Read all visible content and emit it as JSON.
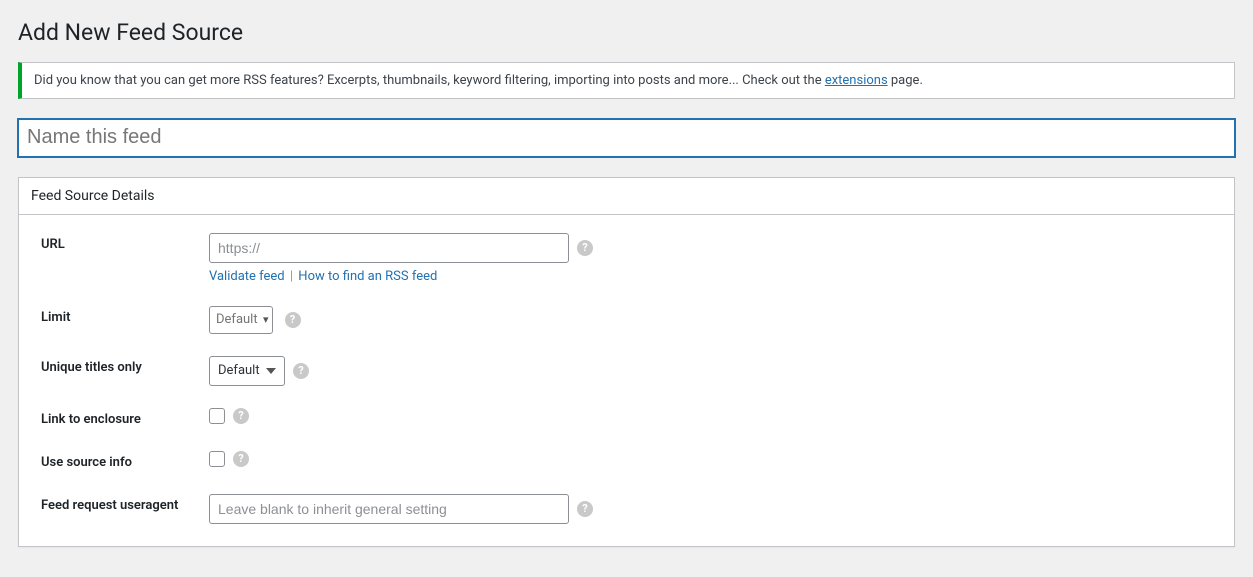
{
  "page_title": "Add New Feed Source",
  "notice": {
    "text_before": "Did you know that you can get more RSS features? Excerpts, thumbnails, keyword filtering, importing into posts and more... Check out the ",
    "link_text": "extensions",
    "text_after": " page."
  },
  "title_field": {
    "placeholder": "Name this feed",
    "value": ""
  },
  "metabox": {
    "title": "Feed Source Details",
    "fields": {
      "url": {
        "label": "URL",
        "placeholder": "https://",
        "value": "",
        "validate_link": "Validate feed",
        "howto_link": "How to find an RSS feed"
      },
      "limit": {
        "label": "Limit",
        "placeholder": "Default"
      },
      "unique_titles": {
        "label": "Unique titles only",
        "selected": "Default",
        "options": [
          "Default"
        ]
      },
      "link_enclosure": {
        "label": "Link to enclosure"
      },
      "use_source_info": {
        "label": "Use source info"
      },
      "useragent": {
        "label": "Feed request useragent",
        "placeholder": "Leave blank to inherit general setting",
        "value": ""
      }
    }
  }
}
